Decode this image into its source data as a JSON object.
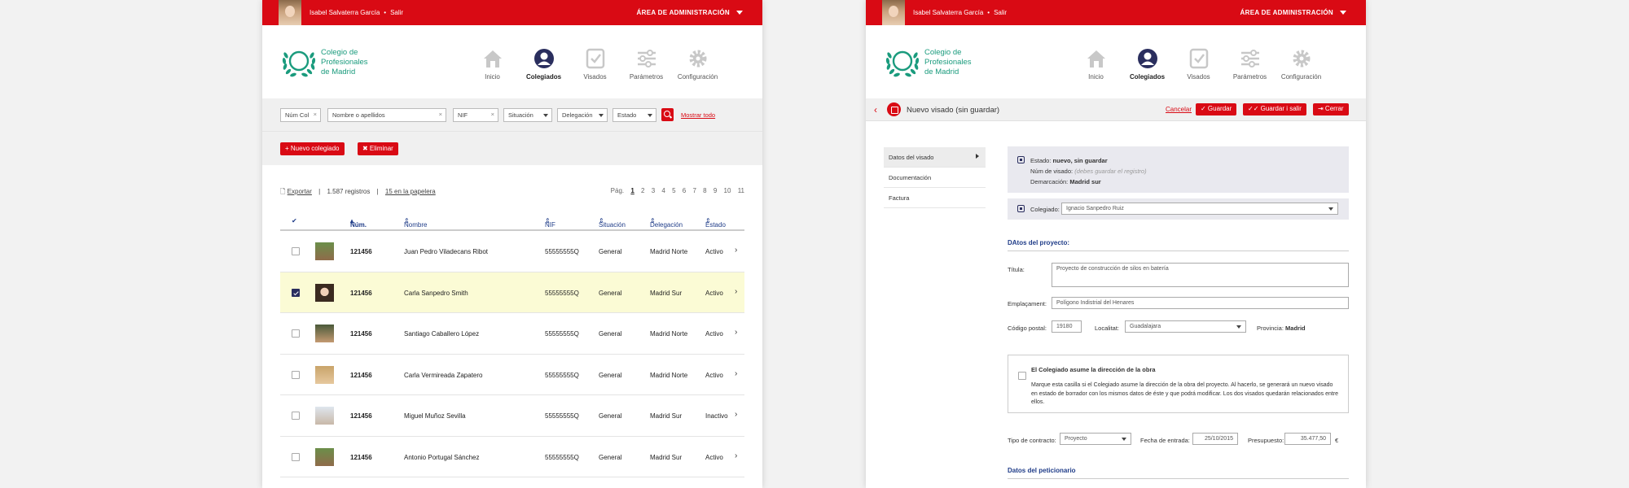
{
  "colors": {
    "brand_red": "#d90a14",
    "logo_green": "#1a9b7d",
    "navy": "#2a2e5e",
    "link_blue": "#1f3c88",
    "selected_row": "#fbfbd5"
  },
  "top": {
    "user": "Isabel Salvaterra García",
    "sep": "•",
    "logout": "Salir",
    "admin": "ÁREA DE ADMINISTRACIÓN"
  },
  "logo": {
    "line1": "Colegio de",
    "line2": "Profesionales",
    "line3": "de Madrid"
  },
  "nav": [
    {
      "label": "Inicio",
      "icon": "home-icon"
    },
    {
      "label": "Colegiados",
      "icon": "user-icon"
    },
    {
      "label": "Visados",
      "icon": "check-document-icon"
    },
    {
      "label": "Parámetros",
      "icon": "sliders-icon"
    },
    {
      "label": "Configuración",
      "icon": "gear-icon"
    }
  ],
  "left": {
    "filters": {
      "num_col": "Núm Col",
      "nombre": "Nombre o apellidos",
      "nif": "NIF",
      "situacion": "Situación",
      "delegacion": "Delegación",
      "estado": "Estado",
      "show_all": "Mostrar todo"
    },
    "actions": {
      "new": "+ Nuevo colegiado",
      "delete": "✖ Eliminar"
    },
    "meta": {
      "export": "Exportar",
      "records": "1.587 registros",
      "sep": "|",
      "trash": "15 en la papelera"
    },
    "pager": {
      "label": "Pág.",
      "pages": [
        "1",
        "2",
        "3",
        "4",
        "5",
        "6",
        "7",
        "8",
        "9",
        "10",
        "11"
      ],
      "current": "1"
    },
    "columns": {
      "check": "✔",
      "num": "Núm.",
      "name": "Nombre",
      "nif": "NIF",
      "situation": "Situación",
      "delegation": "Delegación",
      "status": "Estado"
    },
    "rows": [
      {
        "num": "121456",
        "name": "Juan Pedro Viladecans Ribot",
        "nif": "55555555Q",
        "situation": "General",
        "delegation": "Madrid Norte",
        "status": "Activo",
        "checked": false
      },
      {
        "num": "121456",
        "name": "Carla Sanpedro Smith",
        "nif": "55555555Q",
        "situation": "General",
        "delegation": "Madrid Sur",
        "status": "Activo",
        "checked": true
      },
      {
        "num": "121456",
        "name": "Santiago Caballero López",
        "nif": "55555555Q",
        "situation": "General",
        "delegation": "Madrid Norte",
        "status": "Activo",
        "checked": false
      },
      {
        "num": "121456",
        "name": "Carla Vermireada Zapatero",
        "nif": "55555555Q",
        "situation": "General",
        "delegation": "Madrid Norte",
        "status": "Activo",
        "checked": false
      },
      {
        "num": "121456",
        "name": "Miguel Muñoz Sevilla",
        "nif": "55555555Q",
        "situation": "General",
        "delegation": "Madrid Sur",
        "status": "Inactivo",
        "checked": false
      },
      {
        "num": "121456",
        "name": "Antonio Portugal Sánchez",
        "nif": "55555555Q",
        "situation": "General",
        "delegation": "Madrid Sur",
        "status": "Activo",
        "checked": false
      }
    ]
  },
  "right": {
    "title": "Nuevo visado (sin guardar)",
    "actions": {
      "cancel": "Cancelar",
      "save": "✓ Guardar",
      "save_exit": "✓✓ Guardar i salir",
      "close": "⇥ Cerrar"
    },
    "menu": [
      "Datos del visado",
      "Documentación",
      "Factura"
    ],
    "status": {
      "estado_label": "Estado:",
      "estado_value": "nuevo, sin guardar",
      "num_label": "Núm de visado:",
      "num_value": "(debes guardar el registro)",
      "dem_label": "Demarcación:",
      "dem_value": "Madrid sur"
    },
    "colegiado": {
      "label": "Colegiado:",
      "value": "Ignacio Sanpedro Ruiz"
    },
    "project_section": "DAtos del proyecto:",
    "titulo": {
      "label": "Títula:",
      "value": "Proyecto de construcción de silos en batería"
    },
    "emplacament": {
      "label": "Emplaçament:",
      "value": "Polígono Indistrial del Henares"
    },
    "cp": {
      "label": "Código postal:",
      "value": "19180"
    },
    "localitat": {
      "label": "Localitat:",
      "value": "Guadalajara"
    },
    "provincia": {
      "label": "Provincia:",
      "value": "Madrid"
    },
    "obra": {
      "label": "El Colegiado asume la dirección de la obra",
      "text": "Marque esta casilla si el Colegiado asume la dirección de la obra del proyecto. Al hacerlo, se generará un nuevo visado en estado de borrador con los mismos datos de éste y que podrá modificar. Los dos visados quedarán relacionados entre ellos."
    },
    "contrato": {
      "label": "Tipo de contracto:",
      "value": "Proyecto"
    },
    "fecha": {
      "label": "Fecha de entrada:",
      "value": "25/10/2015"
    },
    "presupuesto": {
      "label": "Presupuesto:",
      "value": "35.477,50",
      "currency": "€"
    },
    "peticionario_section": "Datos del peticionario"
  }
}
